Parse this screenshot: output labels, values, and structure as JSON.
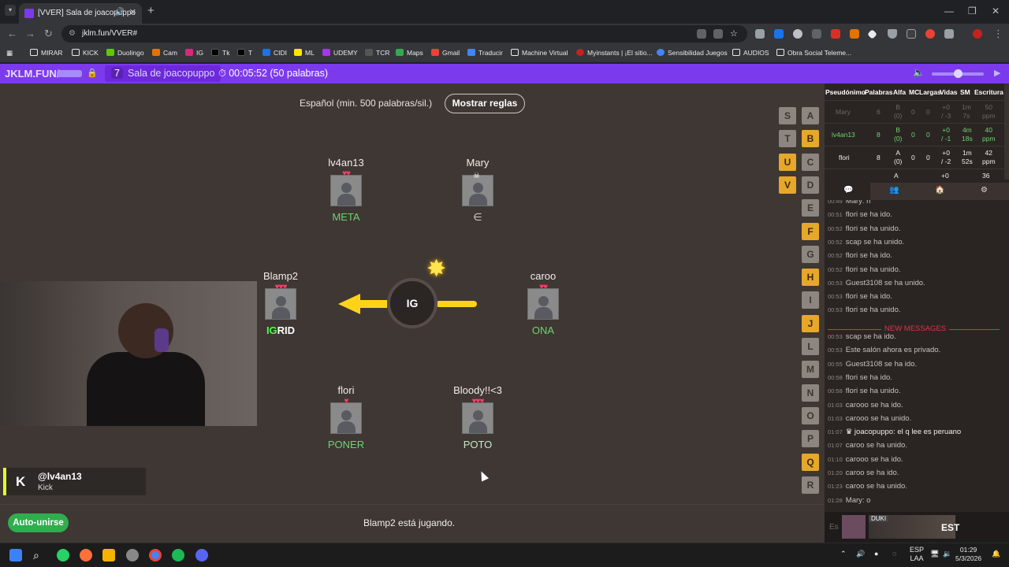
{
  "browser": {
    "tab_title": "[VVER] Sala de joacopuppo",
    "url": "jklm.fun/VVER#",
    "bookmarks": [
      "MIRAR",
      "KICK",
      "Duolingo",
      "Cam",
      "IG",
      "Tk",
      "T",
      "CIDI",
      "ML",
      "UDEMY",
      "TCR",
      "Maps",
      "Gmail",
      "Traducir",
      "Machine Virtual",
      "Myinstants | ¡El sitio...",
      "Sensibilidad Juegos",
      "AUDIOS",
      "Obra Social Teleme..."
    ]
  },
  "gamebar": {
    "brand": "JKLM.FUN/",
    "room_count": "7",
    "room_name": "Sala de joacopuppo",
    "timer": "00:05:52 (50 palabras)"
  },
  "game": {
    "rules_language": "Español (min. 500 palabras/sil.)",
    "rules_button": "Mostrar reglas",
    "syllable": "IG",
    "players": [
      {
        "name": "lv4an13",
        "hearts": "♥♥",
        "word": "META"
      },
      {
        "name": "Mary",
        "hearts": "",
        "word": "∈"
      },
      {
        "name": "Blamp2",
        "hearts": "♥♥♥",
        "word_hl": "IG",
        "word_rest": "RID"
      },
      {
        "name": "caroo",
        "hearts": "♥♥",
        "word": "ONA"
      },
      {
        "name": "flori",
        "hearts": "♥",
        "word": "PONER"
      },
      {
        "name": "Bloody!!<3",
        "hearts": "♥♥♥",
        "word": "POTO"
      }
    ],
    "letters_col1": [
      "S",
      "T",
      "U",
      "V"
    ],
    "letters_col2": [
      "A",
      "B",
      "C",
      "D",
      "E",
      "F",
      "G",
      "H",
      "I",
      "J",
      "L",
      "M",
      "N",
      "O",
      "P",
      "Q",
      "R"
    ],
    "status": "Blamp2 está jugando.",
    "autojoin": "Auto-unirse"
  },
  "kick": {
    "handle": "@lv4an13",
    "platform": "Kick"
  },
  "scoreboard": {
    "headers": [
      "Pseudónimo",
      "Palabras",
      "Alfa",
      "MC",
      "Largas",
      "Vidas",
      "SM",
      "Escritura"
    ],
    "rows": [
      {
        "name": "Mary",
        "words": "6",
        "alfa": "B",
        "alfa2": "(0)",
        "mc": "0",
        "largas": "0",
        "vidas": "+0",
        "vidas2": "/ -3",
        "sm": "1m",
        "sm2": "7s",
        "esc": "50",
        "esc2": "ppm"
      },
      {
        "name": "lv4an13",
        "words": "8",
        "alfa": "B",
        "alfa2": "(0)",
        "mc": "0",
        "largas": "0",
        "vidas": "+0",
        "vidas2": "/ -1",
        "sm": "4m",
        "sm2": "18s",
        "esc": "40",
        "esc2": "ppm"
      },
      {
        "name": "flori",
        "words": "8",
        "alfa": "A",
        "alfa2": "(0)",
        "mc": "0",
        "largas": "0",
        "vidas": "+0",
        "vidas2": "/ -2",
        "sm": "1m",
        "sm2": "52s",
        "esc": "42",
        "esc2": "ppm"
      },
      {
        "name": "",
        "words": "",
        "alfa": "A",
        "alfa2": "",
        "mc": "",
        "largas": "",
        "vidas": "+0",
        "vidas2": "",
        "sm": "",
        "sm2": "",
        "esc": "36",
        "esc2": ""
      }
    ]
  },
  "chat": {
    "new_messages_label": "NEW MESSAGES",
    "messages": [
      {
        "time": "00:49",
        "text": "Mary: n"
      },
      {
        "time": "00:51",
        "text": "flori se ha ido."
      },
      {
        "time": "00:52",
        "text": "flori se ha unido."
      },
      {
        "time": "00:52",
        "text": "scap se ha unido."
      },
      {
        "time": "00:52",
        "text": "flori se ha ido."
      },
      {
        "time": "00:52",
        "text": "flori se ha unido."
      },
      {
        "time": "00:53",
        "text": "Guest3108 se ha unido."
      },
      {
        "time": "00:53",
        "text": "flori se ha ido."
      },
      {
        "time": "00:53",
        "text": "flori se ha unido."
      },
      {
        "time": "00:53",
        "text": "scap se ha ido."
      },
      {
        "time": "00:53",
        "text": "Este salón ahora es privado."
      },
      {
        "time": "00:55",
        "text": "Guest3108 se ha ido."
      },
      {
        "time": "00:58",
        "text": "flori se ha ido."
      },
      {
        "time": "00:58",
        "text": "flori se ha unido."
      },
      {
        "time": "01:03",
        "text": "carooo se ha ido."
      },
      {
        "time": "01:03",
        "text": "carooo se ha unido."
      },
      {
        "time": "01:07",
        "user": "joacopuppo",
        "text": ": el q lee es peruano"
      },
      {
        "time": "01:07",
        "text": "caroo se ha unido."
      },
      {
        "time": "01:10",
        "text": "carooo se ha ido."
      },
      {
        "time": "01:20",
        "text": "caroo se ha ido."
      },
      {
        "time": "01:23",
        "text": "caroo se ha unido."
      },
      {
        "time": "01:28",
        "text": "Mary: o"
      }
    ],
    "input_placeholder": "Es",
    "now_playing_artist": "DUKI",
    "now_playing_label": "EST"
  },
  "taskbar": {
    "lang": "ESP",
    "lang2": "LAA",
    "time": "01:29",
    "date": "5/3/2026"
  },
  "colors": {
    "accent": "#7c3aed",
    "word_ok": "#6fd36f",
    "letter_on": "#e6a72a",
    "bomb_arrow": "#ffd21a",
    "new_messages": "#e0314b"
  }
}
